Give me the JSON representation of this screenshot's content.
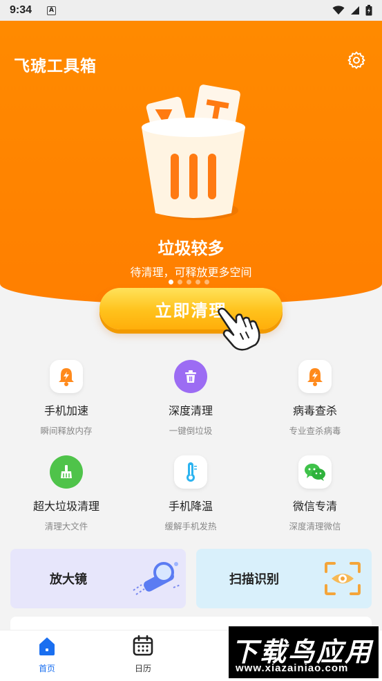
{
  "status_bar": {
    "time": "9:34",
    "a_badge": "A"
  },
  "header": {
    "title": "飞琥工具箱"
  },
  "hero": {
    "title": "垃圾较多",
    "subtitle": "待清理，可释放更多空间",
    "page_count": 5,
    "active_page": 1,
    "cta_label": "立即清理"
  },
  "features": [
    {
      "icon": "bell-bolt-icon",
      "title": "手机加速",
      "subtitle": "瞬间释放内存"
    },
    {
      "icon": "trash-icon",
      "title": "深度清理",
      "subtitle": "一键倒垃圾"
    },
    {
      "icon": "bell-bolt-icon",
      "title": "病毒查杀",
      "subtitle": "专业查杀病毒"
    },
    {
      "icon": "broom-icon",
      "title": "超大垃圾清理",
      "subtitle": "清理大文件"
    },
    {
      "icon": "thermometer-icon",
      "title": "手机降温",
      "subtitle": "缓解手机发热"
    },
    {
      "icon": "wechat-icon",
      "title": "微信专清",
      "subtitle": "深度清理微信"
    }
  ],
  "cards": [
    {
      "label": "放大镜",
      "icon": "magnifier-icon"
    },
    {
      "label": "扫描识别",
      "icon": "scan-eye-icon"
    }
  ],
  "bottom_nav": [
    {
      "label": "首页",
      "icon": "home-icon",
      "active": true
    },
    {
      "label": "日历",
      "icon": "calendar-icon",
      "active": false
    }
  ],
  "watermark": {
    "main": "下载鸟应用",
    "url": "www.xiazainiao.com"
  },
  "colors": {
    "primary_orange": "#ff8400",
    "button_yellow": "#ffc21c",
    "nav_active": "#1a6ff0"
  }
}
